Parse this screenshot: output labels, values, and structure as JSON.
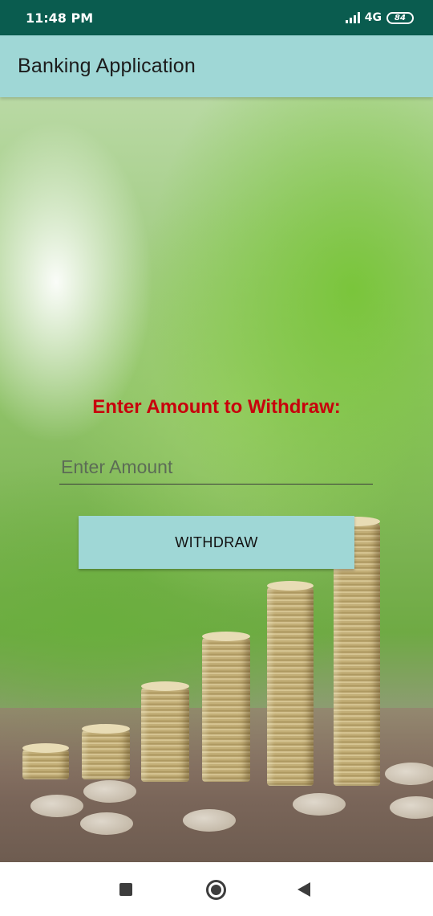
{
  "status_bar": {
    "time": "11:48 PM",
    "network": "4G",
    "battery": "84",
    "icons": [
      "signal-icon",
      "battery-icon"
    ]
  },
  "app_bar": {
    "title": "Banking Application",
    "color": "#9fd7d6"
  },
  "form": {
    "prompt": "Enter Amount to Withdraw:",
    "prompt_color": "#c8000c",
    "amount_value": "",
    "amount_placeholder": "Enter Amount",
    "withdraw_label": "WITHDRAW"
  },
  "nav_bar": {
    "icons": [
      "recents-icon",
      "home-icon",
      "back-icon"
    ]
  }
}
